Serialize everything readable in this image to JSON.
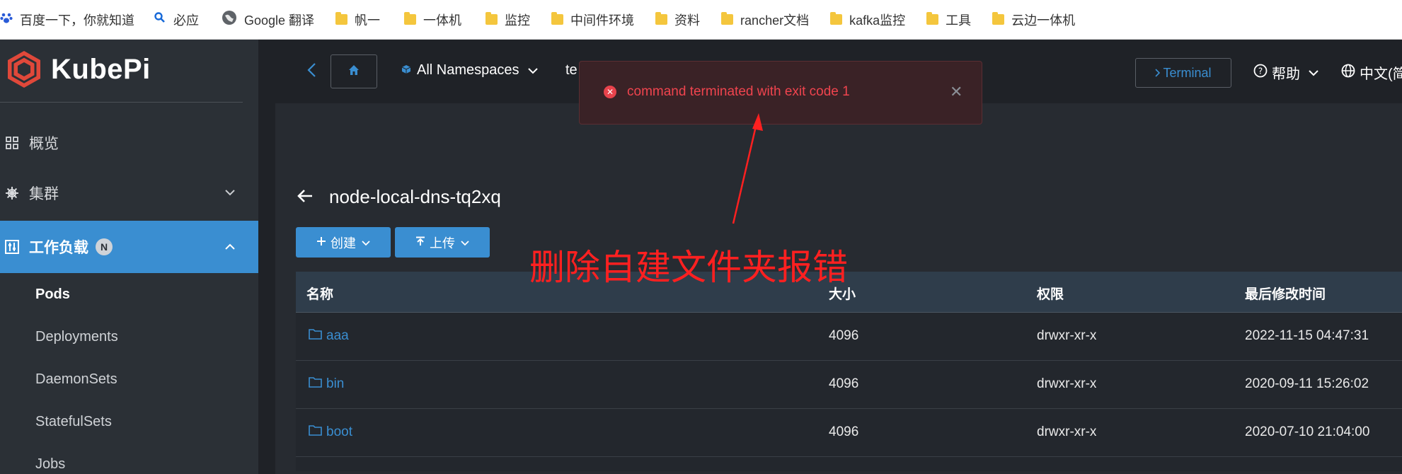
{
  "bookmarks": [
    {
      "label": "百度一下，你就知道",
      "icon": "baidu-paw-icon"
    },
    {
      "label": "必应",
      "icon": "bing-search-icon"
    },
    {
      "label": "Google 翻译",
      "icon": "globe-icon"
    },
    {
      "label": "帆一",
      "icon": "folder-icon"
    },
    {
      "label": "一体机",
      "icon": "folder-icon"
    },
    {
      "label": "监控",
      "icon": "folder-icon"
    },
    {
      "label": "中间件环境",
      "icon": "folder-icon"
    },
    {
      "label": "资料",
      "icon": "folder-icon"
    },
    {
      "label": "rancher文档",
      "icon": "folder-icon"
    },
    {
      "label": "kafka监控",
      "icon": "folder-icon"
    },
    {
      "label": "工具",
      "icon": "folder-icon"
    },
    {
      "label": "云边一体机",
      "icon": "folder-icon"
    }
  ],
  "app": {
    "logo_text": "KubePi"
  },
  "sidebar": {
    "overview": "概览",
    "cluster": "集群",
    "workload": "工作负载",
    "workload_badge": "N",
    "sub": [
      "Pods",
      "Deployments",
      "DaemonSets",
      "StatefulSets",
      "Jobs"
    ]
  },
  "topbar": {
    "namespace": "All Namespaces",
    "cut_text": "te",
    "terminal": "Terminal",
    "help": "帮助",
    "lang": "中文(简"
  },
  "page": {
    "title": "node-local-dns-tq2xq",
    "create_btn": "创建",
    "upload_btn": "上传"
  },
  "table": {
    "headers": [
      "名称",
      "大小",
      "权限",
      "最后修改时间"
    ],
    "rows": [
      {
        "name": "aaa",
        "size": "4096",
        "perm": "drwxr-xr-x",
        "mtime": "2022-11-15 04:47:31"
      },
      {
        "name": "bin",
        "size": "4096",
        "perm": "drwxr-xr-x",
        "mtime": "2020-09-11 15:26:02"
      },
      {
        "name": "boot",
        "size": "4096",
        "perm": "drwxr-xr-x",
        "mtime": "2020-07-10 21:04:00"
      }
    ]
  },
  "toast": {
    "message": "command terminated with exit code 1"
  },
  "annotation": {
    "text": "删除自建文件夹报错",
    "color": "#ff2020"
  },
  "colors": {
    "accent": "#3a8ed1",
    "sidebar_bg": "#2b3036",
    "error": "#f0444e"
  }
}
